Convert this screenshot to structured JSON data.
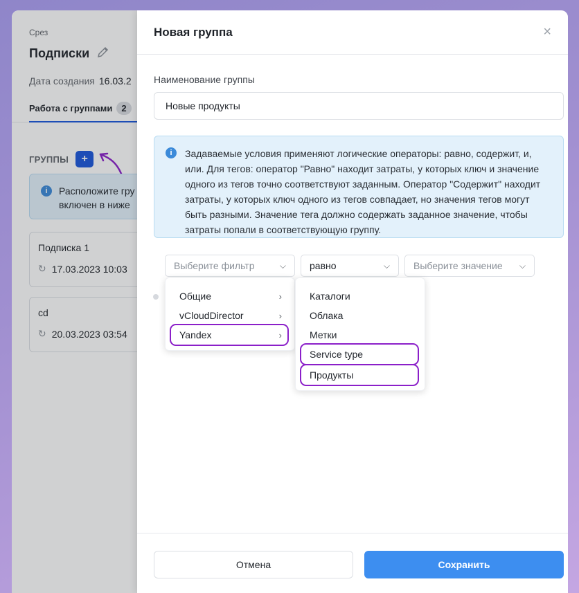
{
  "background": {
    "slice_label": "Срез",
    "title": "Подписки",
    "date_label": "Дата создания",
    "date_value": "16.03.2",
    "tab_label": "Работа с группами",
    "tab_count": "2",
    "groups_label": "ГРУППЫ",
    "add_label": "+",
    "info_line1": "Расположите гру",
    "info_line2": "включен в ниже",
    "cards": [
      {
        "name": "Подписка 1",
        "date": "17.03.2023 10:03"
      },
      {
        "name": "cd",
        "date": "20.03.2023 03:54"
      }
    ]
  },
  "modal": {
    "title": "Новая группа",
    "close": "×",
    "name_label": "Наименование группы",
    "name_value": "Новые продукты",
    "info_text": "Задаваемые условия применяют логические операторы: равно, содержит, и, или. Для тегов: оператор \"Равно\" находит затраты, у которых ключ и значение одного из тегов точно соответствуют заданным. Оператор \"Содержит\" находит затраты, у которых ключ одного из тегов совпадает, но значения тегов могут быть разными. Значение тега должно содержать заданное значение, чтобы затраты попали в соответствующую группу.",
    "filter_placeholder": "Выберите фильтр",
    "operator_value": "равно",
    "value_placeholder": "Выберите значение",
    "filter_menu": [
      "Общие",
      "vCloudDirector",
      "Yandex"
    ],
    "submenu": [
      "Каталоги",
      "Облака",
      "Метки",
      "Service type",
      "Продукты"
    ],
    "cancel_label": "Отмена",
    "save_label": "Сохранить"
  },
  "colors": {
    "accent": "#3d8ef0",
    "highlight": "#8b1fc9",
    "info_bg": "#e3f1fb"
  }
}
